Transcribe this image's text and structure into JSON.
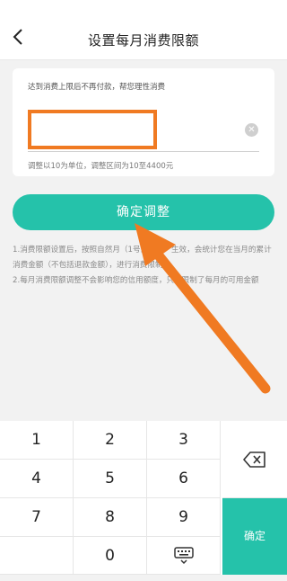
{
  "header": {
    "title": "设置每月消费限额",
    "back_icon": "chevron-left-icon"
  },
  "limit_card": {
    "hint": "达到消费上限后不再付款，帮您理性消费",
    "amount_value": "",
    "clear_icon": "clear-icon",
    "range_note": "调整以10为单位，调整区间为10至4400元"
  },
  "confirm_button": {
    "label": "确定调整"
  },
  "notes": [
    "1.消费限额设置后，按照自然月（1号到月末）生效，会统计您在当月的累计消费金额（不包括退款金额），进行消费限制；",
    "2.每月消费限额调整不会影响您的信用额度，只是限制了每月的可用金额"
  ],
  "annotation": {
    "highlight_color": "#f07a22",
    "arrow_color": "#f07a22"
  },
  "keypad": {
    "keys": [
      "1",
      "2",
      "3",
      "4",
      "5",
      "6",
      "7",
      "8",
      "9",
      "0"
    ],
    "delete_icon": "backspace-icon",
    "keyboard_icon": "keyboard-hide-icon",
    "ok_label": "确定"
  },
  "colors": {
    "accent": "#25c2aa",
    "background": "#f2f2f2"
  }
}
